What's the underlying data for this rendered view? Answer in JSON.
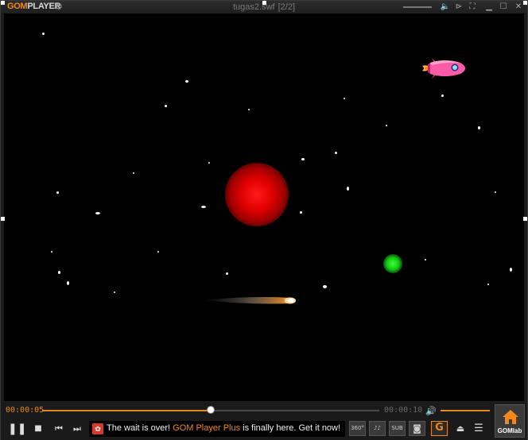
{
  "app": {
    "logo_gom": "GOM",
    "logo_player": "PLAYER",
    "logo_icon": "gear-icon",
    "window_title": "tugas2.swf",
    "playlist_position": "[2/2]"
  },
  "title_controls": [
    "volume-icon",
    "playback-controls-icon",
    "compact-mode-icon",
    "minimize-icon",
    "maximize-icon",
    "close-icon"
  ],
  "playback": {
    "current_time": "00:00:05",
    "total_time": "00:00:10",
    "progress": 0.5,
    "volume": 1.0
  },
  "controls": {
    "pause_icon": "pause-icon",
    "stop_icon": "stop-icon",
    "prev_icon": "previous-icon",
    "next_icon": "next-icon"
  },
  "notice": {
    "part1": "The wait is over! ",
    "highlight": "GOM Player Plus",
    "part2": " is finally here. Get it now!"
  },
  "right_buttons": {
    "vr": "360°",
    "eq": "♪♪",
    "sub": "SUB",
    "capture_icon": "camera-icon",
    "gom": "G",
    "eject_icon": "eject-icon",
    "menu_icon": "menu-icon"
  },
  "gomlab": {
    "label": "GOMlab"
  },
  "colors": {
    "accent": "#e8891c",
    "video_bg": "#000000",
    "planet_red": "#ff0000",
    "planet_green": "#22dd22"
  }
}
